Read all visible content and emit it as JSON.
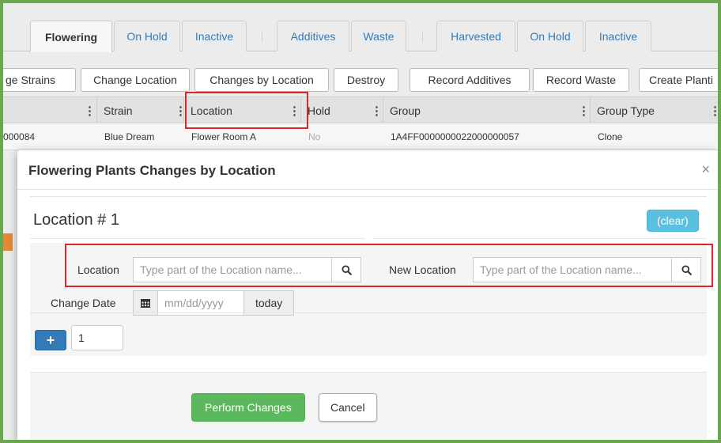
{
  "tabs": [
    {
      "label": "Flowering",
      "active": true
    },
    {
      "label": "On Hold"
    },
    {
      "label": "Inactive"
    },
    {
      "label": "Additives"
    },
    {
      "label": "Waste"
    },
    {
      "label": "Harvested"
    },
    {
      "label": "On Hold"
    },
    {
      "label": "Inactive"
    }
  ],
  "toolbar": [
    "ge Strains",
    "Change Location",
    "Changes by Location",
    "Destroy",
    "Record Additives",
    "Record Waste",
    "Create Planti"
  ],
  "grid": {
    "columns": [
      "Strain",
      "Location",
      "Hold",
      "Group",
      "Group Type"
    ],
    "row": {
      "id": "000084",
      "strain": "Blue Dream",
      "location": "Flower Room A",
      "hold": "No",
      "group": "1A4FF0000000022000000057",
      "group_type": "Clone"
    }
  },
  "modal": {
    "title": "Flowering Plants Changes by Location",
    "close_symbol": "×",
    "section_title": "Location # 1",
    "clear_label": "(clear)",
    "location_label": "Location",
    "location_placeholder": "Type part of the Location name...",
    "new_location_label": "New Location",
    "new_location_placeholder": "Type part of the Location name...",
    "change_date_label": "Change Date",
    "date_placeholder": "mm/dd/yyyy",
    "today_label": "today",
    "plus_label": "+",
    "count_value": "1",
    "perform_label": "Perform Changes",
    "cancel_label": "Cancel"
  },
  "colors": {
    "frame_border": "#6aa84f",
    "highlight": "#e0242c",
    "primary": "#337ab7",
    "info": "#5bc0de",
    "success": "#5cb85c",
    "accent_orange": "#e4893b"
  }
}
